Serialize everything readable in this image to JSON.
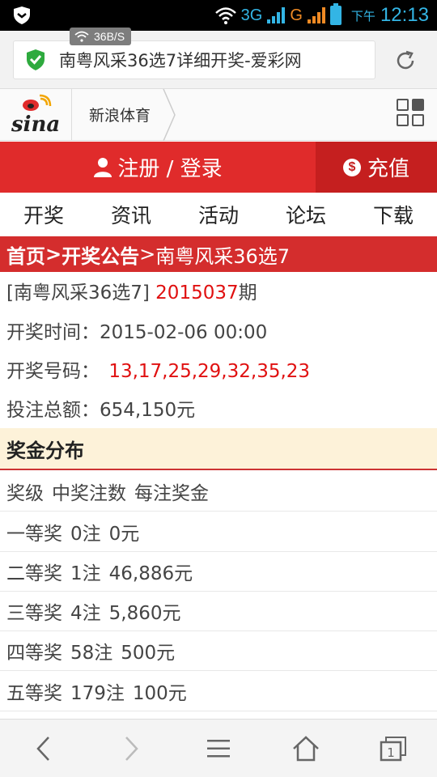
{
  "status_bar": {
    "net1": "3G",
    "net2": "G",
    "time_label": "下午",
    "time": "12:13"
  },
  "address_bar": {
    "speed": "36B/S",
    "page_title": "南粤风采36选7详细开奖-爱彩网"
  },
  "sina_header": {
    "channel": "新浪体育"
  },
  "login_bar": {
    "login_label": "注册 / 登录",
    "recharge_label": "充值",
    "bg_color": "#e02b2b"
  },
  "nav": {
    "items": [
      "开奖",
      "资讯",
      "活动",
      "论坛",
      "下载"
    ]
  },
  "breadcrumb": {
    "home": "首页",
    "sep1": ">",
    "announcement": "开奖公告",
    "sep2": ">",
    "current": "南粤风采36选7"
  },
  "draw": {
    "lottery_name": "[南粤风采36选7]",
    "issue_number": "2015037",
    "issue_suffix": "期",
    "time_label": "开奖时间：",
    "time_value": "2015-02-06 00:00",
    "numbers_label": "开奖号码：",
    "numbers_value": "13,17,25,29,32,35,23",
    "total_label": "投注总额：",
    "total_value": "654,150元"
  },
  "prize": {
    "section_title": "奖金分布",
    "headers": [
      "奖级",
      "中奖注数",
      "每注奖金"
    ],
    "rows": [
      {
        "level": "一等奖",
        "count": "0注",
        "amount": "0元"
      },
      {
        "level": "二等奖",
        "count": "1注",
        "amount": "46,886元"
      },
      {
        "level": "三等奖",
        "count": "4注",
        "amount": "5,860元"
      },
      {
        "level": "四等奖",
        "count": "58注",
        "amount": "500元"
      },
      {
        "level": "五等奖",
        "count": "179注",
        "amount": "100元"
      }
    ]
  },
  "toolbar": {
    "tab_count": "1"
  }
}
